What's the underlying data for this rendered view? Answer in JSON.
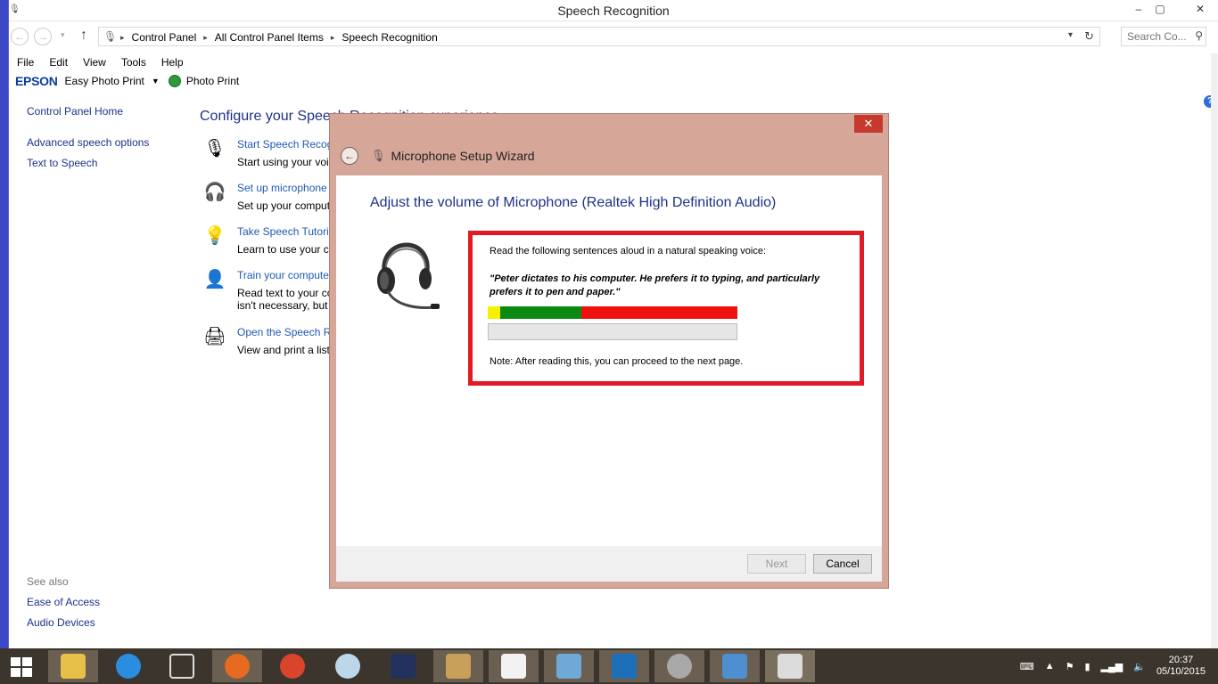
{
  "window": {
    "title": "Speech Recognition",
    "min_glyph": "–",
    "max_glyph": "▢",
    "close_glyph": "✕"
  },
  "nav": {
    "back_glyph": "←",
    "fwd_glyph": "→",
    "drop_glyph": "▾",
    "up_glyph": "↑"
  },
  "address": {
    "crumbs": [
      "Control Panel",
      "All Control Panel Items",
      "Speech Recognition"
    ],
    "sep_glyph": "▸",
    "refresh_glyph": "↻"
  },
  "search": {
    "placeholder": "Search Co...",
    "icon_glyph": "⚲"
  },
  "menu": [
    "File",
    "Edit",
    "View",
    "Tools",
    "Help"
  ],
  "epson": {
    "logo": "EPSON",
    "easy_photo": "Easy Photo Print",
    "photo_print": "Photo Print",
    "drop_glyph": "▼"
  },
  "help_glyph": "?",
  "leftpane": {
    "home": "Control Panel Home",
    "items": [
      "Advanced speech options",
      "Text to Speech"
    ],
    "see_also": "See also",
    "see_also_items": [
      "Ease of Access",
      "Audio Devices"
    ]
  },
  "main": {
    "heading": "Configure your Speech Recognition experience",
    "tasks": [
      {
        "icon": "microphone-icon",
        "glyph": "🎙",
        "link": "Start Speech Recognition",
        "desc": "Start using your voice to control your computer."
      },
      {
        "icon": "headset-icon",
        "glyph": "🎧",
        "link": "Set up microphone",
        "desc": "Set up your computer to work properly with Speech Recognition."
      },
      {
        "icon": "lightbulb-icon",
        "glyph": "💡",
        "link": "Take Speech Tutorial",
        "desc": "Learn to use your computer with speech."
      },
      {
        "icon": "user-train-icon",
        "glyph": "👤",
        "link": "Train your computer to better understand you",
        "desc": "Read text to your computer to improve its ability to recognize your voice.",
        "desc2": "isn't necessary, but can help improve dictation accuracy."
      },
      {
        "icon": "printer-icon",
        "glyph": "🖨",
        "link": "Open the Speech Reference Card",
        "desc": "View and print a list of common commands to keep with you."
      }
    ]
  },
  "wizard": {
    "close_glyph": "✕",
    "back_glyph": "←",
    "title": "Microphone Setup Wizard",
    "heading": "Adjust the volume of Microphone (Realtek High Definition Audio)",
    "intro": "Read the following sentences aloud in a natural speaking voice:",
    "quote": "\"Peter dictates to his computer. He prefers it to typing, and particularly prefers it to pen and paper.\"",
    "note": "Note: After reading this, you can proceed to the next page.",
    "progress": 0,
    "next_label": "Next",
    "cancel_label": "Cancel",
    "colors": {
      "frame": "#d6a799",
      "highlight": "#e21a23",
      "yellow": "#f5f100",
      "green": "#0b8a12",
      "red": "#f0110f"
    }
  },
  "taskbar": {
    "time": "20:37",
    "date": "05/10/2015",
    "tray_up_glyph": "▲"
  }
}
